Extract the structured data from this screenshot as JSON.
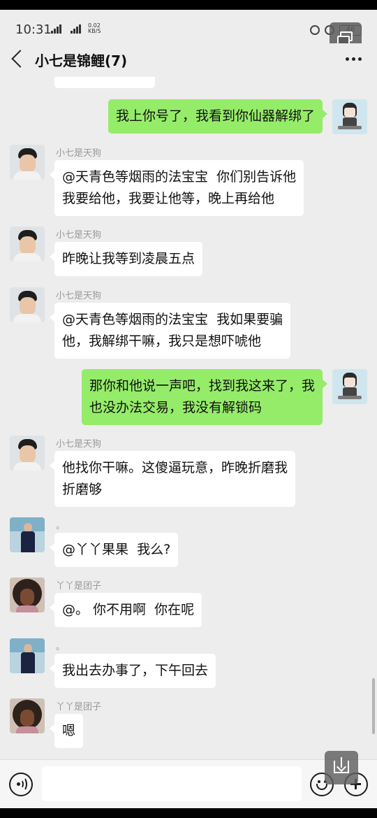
{
  "status_bar": {
    "time": "10:31",
    "network_1": "3G",
    "network_2": "4G+",
    "speed_value": "0.02",
    "speed_unit": "KB/S",
    "battery": "46"
  },
  "header": {
    "title": "小七是锦鲤(7)",
    "back_icon": "chevron-left-icon",
    "more_icon": "more-dots-icon"
  },
  "messages": [
    {
      "side": "right",
      "avatar": "cartoon",
      "text": "我上你号了，我看到你仙器解绑了"
    },
    {
      "side": "left",
      "sender": "小七是天狗",
      "avatar": "man",
      "text": "@天青色等烟雨的法宝宝  你们别告诉他\n我要给他，我要让他等，晚上再给他"
    },
    {
      "side": "left",
      "sender": "小七是天狗",
      "avatar": "man",
      "text": "昨晚让我等到凌晨五点"
    },
    {
      "side": "left",
      "sender": "小七是天狗",
      "avatar": "man",
      "text": "@天青色等烟雨的法宝宝  我如果要骗\n他，我解绑干嘛，我只是想吓唬他"
    },
    {
      "side": "right",
      "avatar": "cartoon",
      "text": "那你和他说一声吧，找到我这来了，我\n也没办法交易，我没有解锁码"
    },
    {
      "side": "left",
      "sender": "小七是天狗",
      "avatar": "man",
      "text": "他找你干嘛。这傻逼玩意，昨晚折磨我\n折磨够"
    },
    {
      "side": "left",
      "sender": "。",
      "avatar": "girl",
      "text": "@丫丫果果  我么?"
    },
    {
      "side": "left",
      "sender": "丫丫是团子",
      "avatar": "curly",
      "text": "@。 你不用啊  你在呢"
    },
    {
      "side": "left",
      "sender": "。",
      "avatar": "girl",
      "text": "我出去办事了，下午回去"
    },
    {
      "side": "left",
      "sender": "丫丫是团子",
      "avatar": "curly",
      "text": "嗯"
    }
  ],
  "input_bar": {
    "voice_icon": "voice-icon",
    "text_value": "",
    "emoji_icon": "emoji-icon",
    "plus_icon": "plus-icon"
  },
  "floating": {
    "window_icon": "floating-window-icon",
    "download_icon": "download-icon"
  }
}
